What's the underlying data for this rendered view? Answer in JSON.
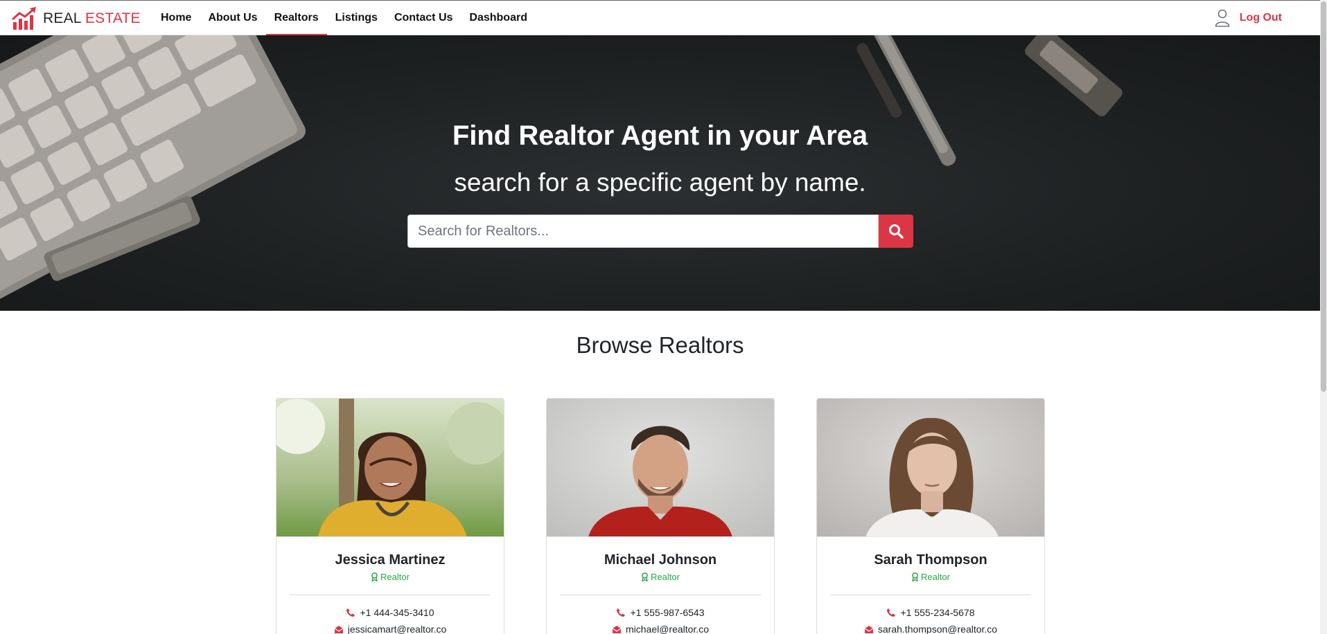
{
  "navbar": {
    "brand_part1": "REAL",
    "brand_part2": "ESTATE",
    "items": [
      {
        "label": "Home",
        "active": false
      },
      {
        "label": "About Us",
        "active": false
      },
      {
        "label": "Realtors",
        "active": true
      },
      {
        "label": "Listings",
        "active": false
      },
      {
        "label": "Contact Us",
        "active": false
      },
      {
        "label": "Dashboard",
        "active": false
      }
    ],
    "logout_label": "Log Out",
    "user_icon": "user-outline-icon"
  },
  "hero": {
    "title": "Find Realtor Agent in your Area",
    "subtitle": "search for a specific agent by name.",
    "search_placeholder": "Search for Realtors...",
    "search_icon": "search-icon"
  },
  "browse": {
    "title": "Browse Realtors",
    "realtors": [
      {
        "name": "Jessica Martinez",
        "role": "Realtor",
        "phone": "+1 444-345-3410",
        "email": "jessicamart@realtor.co"
      },
      {
        "name": "Michael Johnson",
        "role": "Realtor",
        "phone": "+1 555-987-6543",
        "email": "michael@realtor.co"
      },
      {
        "name": "Sarah Thompson",
        "role": "Realtor",
        "phone": "+1 555-234-5678",
        "email": "sarah.thompson@realtor.co"
      }
    ]
  },
  "colors": {
    "accent": "#dc3545",
    "realtor_badge": "#28a745",
    "hero_bg": "#1e2122"
  }
}
